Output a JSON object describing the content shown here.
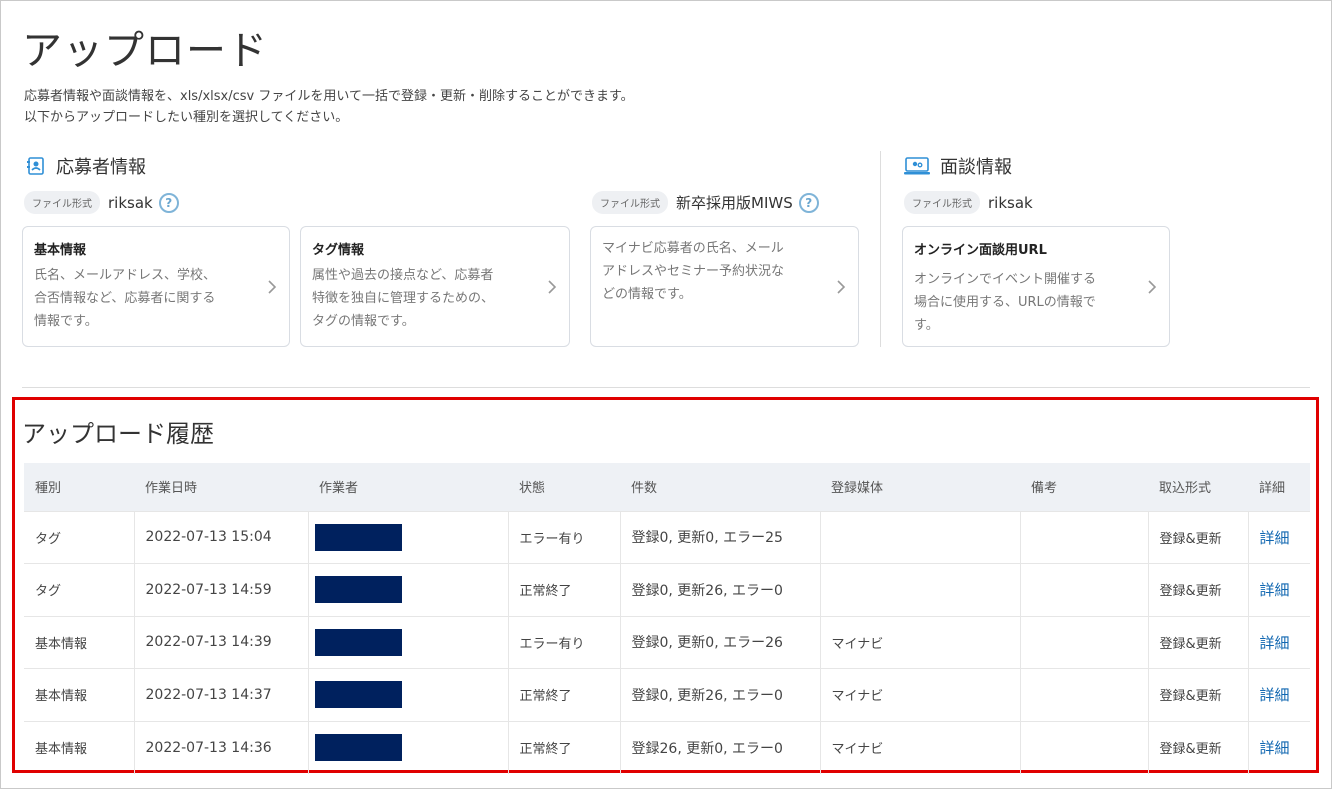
{
  "page": {
    "title": "アップロード",
    "description_line1": "応募者情報や面談情報を、xls/xlsx/csv ファイルを用いて一括で登録・更新・削除することができます。",
    "description_line2": "以下からアップロードしたい種別を選択してください。"
  },
  "applicant_section": {
    "heading": "応募者情報",
    "icon": "applicant-card-icon",
    "format_label": "ファイル形式",
    "format_riksak": "riksak",
    "format_miws": "新卒採用版MIWS",
    "cards": [
      {
        "title": "基本情報",
        "body": [
          "氏名、メールアドレス、学校、",
          "合否情報など、応募者に関する",
          "情報です。"
        ]
      },
      {
        "title": "タグ情報",
        "body": [
          "属性や過去の接点など、応募者",
          "特徴を独自に管理するための、",
          "タグの情報です。"
        ]
      },
      {
        "title": "",
        "body": [
          "マイナビ応募者の氏名、メール",
          "アドレスやセミナー予約状況な",
          "どの情報です。"
        ]
      }
    ]
  },
  "interview_section": {
    "heading": "面談情報",
    "icon": "interview-screen-icon",
    "format_label": "ファイル形式",
    "format_value": "riksak",
    "card": {
      "title": "オンライン面談用URL",
      "body": [
        "オンラインでイベント開催する",
        "場合に使用する、URLの情報で",
        "す。"
      ]
    }
  },
  "history": {
    "title": "アップロード履歴",
    "columns": [
      "種別",
      "作業日時",
      "作業者",
      "状態",
      "件数",
      "登録媒体",
      "備考",
      "取込形式",
      "詳細"
    ],
    "rows": [
      {
        "type": "タグ",
        "datetime": "2022-07-13 15:04",
        "status": "エラー有り",
        "count": "登録0, 更新0, エラー25",
        "media": "",
        "note": "",
        "import": "登録&更新",
        "detail": "詳細"
      },
      {
        "type": "タグ",
        "datetime": "2022-07-13 14:59",
        "status": "正常終了",
        "count": "登録0, 更新26, エラー0",
        "media": "",
        "note": "",
        "import": "登録&更新",
        "detail": "詳細"
      },
      {
        "type": "基本情報",
        "datetime": "2022-07-13 14:39",
        "status": "エラー有り",
        "count": "登録0, 更新0, エラー26",
        "media": "マイナビ",
        "note": "",
        "import": "登録&更新",
        "detail": "詳細"
      },
      {
        "type": "基本情報",
        "datetime": "2022-07-13 14:37",
        "status": "正常終了",
        "count": "登録0, 更新26, エラー0",
        "media": "マイナビ",
        "note": "",
        "import": "登録&更新",
        "detail": "詳細"
      },
      {
        "type": "基本情報",
        "datetime": "2022-07-13 14:36",
        "status": "正常終了",
        "count": "登録26, 更新0, エラー0",
        "media": "マイナビ",
        "note": "",
        "import": "登録&更新",
        "detail": "詳細"
      }
    ]
  },
  "colors": {
    "accent": "#1167b1",
    "highlight_border": "#e00000",
    "redaction": "#00215e",
    "header_bg": "#eef1f5"
  }
}
